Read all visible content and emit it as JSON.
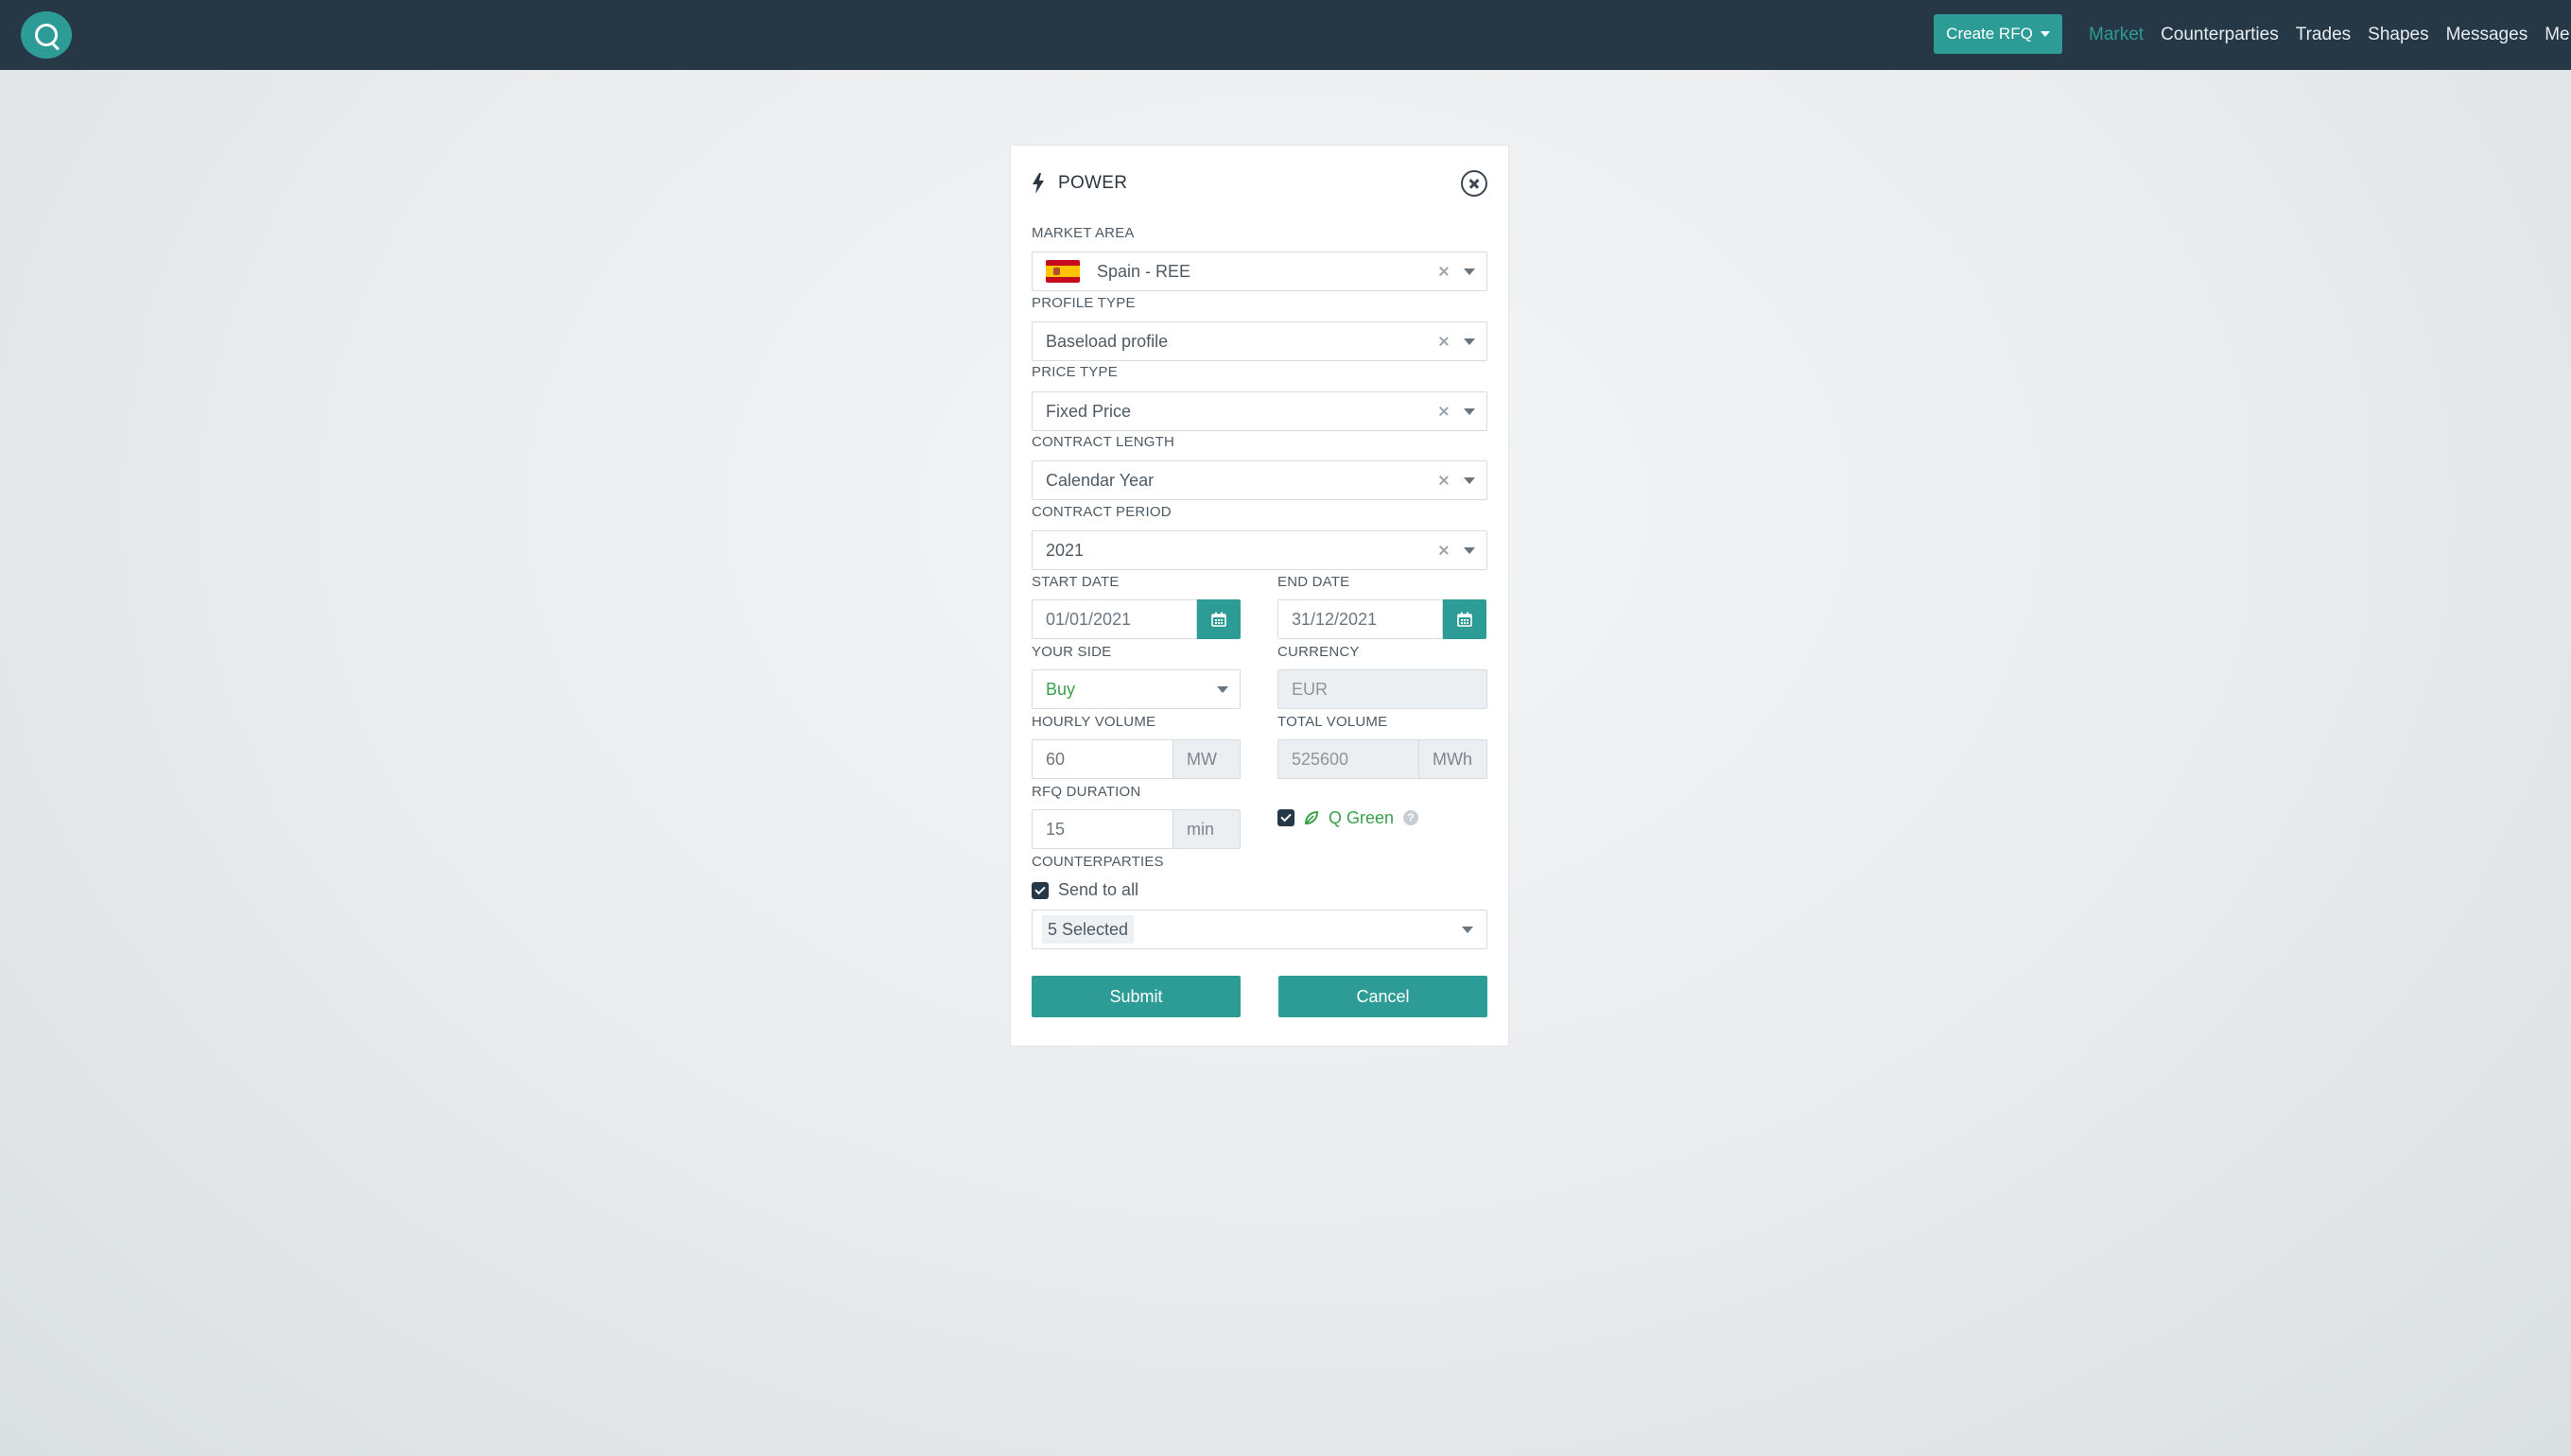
{
  "nav": {
    "create_rfq_label": "Create RFQ",
    "links": [
      "Market",
      "Counterparties",
      "Trades",
      "Shapes",
      "Messages",
      "Me"
    ],
    "active": "Market"
  },
  "modal": {
    "title": "POWER",
    "market_area": {
      "label": "MARKET AREA",
      "value": "Spain - REE",
      "flag": "spain-flag"
    },
    "profile_type": {
      "label": "PROFILE TYPE",
      "value": "Baseload profile"
    },
    "price_type": {
      "label": "PRICE TYPE",
      "value": "Fixed Price"
    },
    "contract_length": {
      "label": "CONTRACT LENGTH",
      "value": "Calendar Year"
    },
    "contract_period": {
      "label": "CONTRACT PERIOD",
      "value": "2021"
    },
    "start_date": {
      "label": "START DATE",
      "value": "01/01/2021"
    },
    "end_date": {
      "label": "END DATE",
      "value": "31/12/2021"
    },
    "your_side": {
      "label": "YOUR SIDE",
      "value": "Buy"
    },
    "currency": {
      "label": "CURRENCY",
      "value": "EUR"
    },
    "hourly_volume": {
      "label": "HOURLY VOLUME",
      "value": "60",
      "unit": "MW"
    },
    "total_volume": {
      "label": "TOTAL VOLUME",
      "value": "525600",
      "unit": "MWh"
    },
    "rfq_duration": {
      "label": "RFQ DURATION",
      "value": "15",
      "unit": "min"
    },
    "q_green": {
      "label": "Q Green",
      "checked": true
    },
    "counterparties": {
      "label": "COUNTERPARTIES",
      "send_to_all_label": "Send to all",
      "send_to_all_checked": true,
      "selected_text": "5 Selected"
    },
    "submit_label": "Submit",
    "cancel_label": "Cancel"
  },
  "colors": {
    "navbar": "#263746",
    "accent": "#2e9c96",
    "green": "#3aa04b"
  }
}
